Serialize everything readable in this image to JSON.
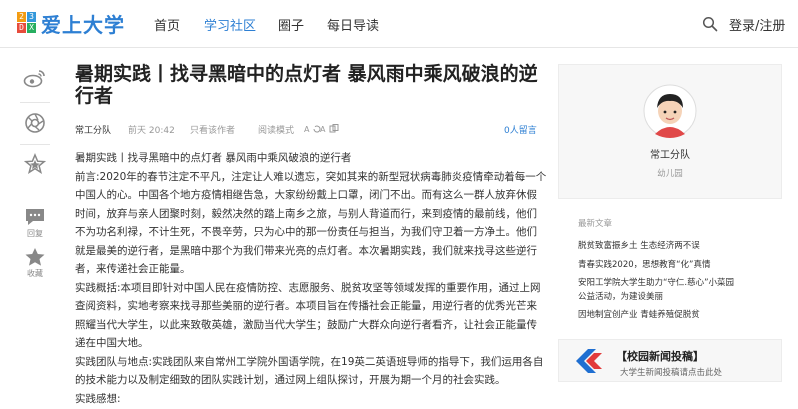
{
  "header": {
    "logo_text": "爱上大学",
    "logo_digits": [
      "2",
      "3",
      "D",
      "X"
    ],
    "nav": [
      "首页",
      "学习社区",
      "圈子",
      "每日导读"
    ],
    "login": "登录/注册"
  },
  "sidebar": {
    "items": [
      {
        "icon": "weibo-icon"
      },
      {
        "icon": "camera-shutter-icon"
      },
      {
        "icon": "star-icon"
      },
      {
        "icon": "comment-icon",
        "label": "回复"
      },
      {
        "icon": "star-icon",
        "label": "收藏"
      }
    ]
  },
  "article": {
    "title": "暑期实践丨找寻黑暗中的点灯者 暴风雨中乘风破浪的逆行者",
    "author": "常工分队",
    "time": "前天 20:42",
    "author_only": "只看该作者",
    "read_mode": "阅读模式",
    "comments": "0人留言",
    "paragraphs": [
      "暑期实践丨找寻黑暗中的点灯者 暴风雨中乘风破浪的逆行者",
      "前言:2020年的春节注定不平凡，注定让人难以遗忘，突如其来的新型冠状病毒肺炎疫情牵动着每一个中国人的心。中国各个地方疫情相继告急，大家纷纷戴上口罩，闭门不出。而有这么一群人放弃休假时间，放弃与亲人团聚时刻，毅然决然的踏上南乡之旅，与别人背道而行，来到疫情的最前线，他们不为功名利禄，不计生死，不畏辛劳，只为心中的那一份责任与担当，为我们守卫着一方净土。他们就是最美的逆行者，是黑暗中那个为我们带来光亮的点灯者。本次暑期实践，我们就来找寻这些逆行者，来传递社会正能量。",
      "实践概括:本项目即针对中国人民在疫情防控、志愿服务、脱贫攻坚等领域发挥的重要作用，通过上网查阅资料，实地考察来找寻那些美丽的逆行者。本项目旨在传播社会正能量，用逆行者的优秀光芒来照耀当代大学生，以此来致敬英雄，激励当代大学生；鼓励广大群众向逆行者看齐，让社会正能量传递在中国大地。",
      "实践团队与地点:实践团队来自常州工学院外国语学院，在19英二英语班导师的指导下，我们运用各自的技术能力以及制定细致的团队实践计划，通过网上组队探讨，开展为期一个月的社会实践。",
      "实践感想:"
    ]
  },
  "profile": {
    "name": "常工分队",
    "subtitle": "幼儿园"
  },
  "recent": {
    "heading": "最新文章",
    "items": [
      "脱贫致富振乡土 生态经济两不误",
      "青春实践2020，思想教育“化”真情",
      "安阳工学院大学生助力“守仁.慈心”小菜园公益活动，为建设美丽",
      "因地制宜创产业 青蛙养殖促脱贫"
    ]
  },
  "banner": {
    "title": "【校园新闻投稿】",
    "subtitle": "大学生新闻投稿请点击此处"
  },
  "colors": {
    "accent": "#2d7fd3",
    "logo_squares": [
      "#f39c12",
      "#3498db",
      "#e74c3c",
      "#27ae60"
    ]
  }
}
